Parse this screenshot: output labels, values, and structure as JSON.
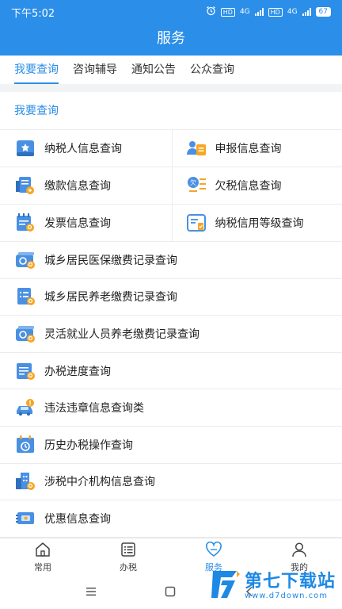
{
  "status_bar": {
    "time": "下午5:02",
    "hd1": "HD",
    "net1": "4G",
    "hd2": "HD",
    "net2": "4G",
    "battery": "67"
  },
  "header": {
    "title": "服务"
  },
  "tabs": [
    {
      "label": "我要查询",
      "active": true
    },
    {
      "label": "咨询辅导",
      "active": false
    },
    {
      "label": "通知公告",
      "active": false
    },
    {
      "label": "公众查询",
      "active": false
    }
  ],
  "section": {
    "title": "我要查询"
  },
  "grid_items": [
    {
      "label": "纳税人信息查询",
      "icon": "taxpayer-info-icon"
    },
    {
      "label": "申报信息查询",
      "icon": "declaration-info-icon"
    },
    {
      "label": "缴款信息查询",
      "icon": "payment-info-icon"
    },
    {
      "label": "欠税信息查询",
      "icon": "tax-arrears-icon"
    },
    {
      "label": "发票信息查询",
      "icon": "invoice-info-icon"
    },
    {
      "label": "纳税信用等级查询",
      "icon": "credit-rating-icon"
    }
  ],
  "list_items": [
    {
      "label": "城乡居民医保缴费记录查询",
      "icon": "medical-insurance-icon"
    },
    {
      "label": "城乡居民养老缴费记录查询",
      "icon": "pension-icon"
    },
    {
      "label": "灵活就业人员养老缴费记录查询",
      "icon": "flexible-employment-icon"
    },
    {
      "label": "办税进度查询",
      "icon": "progress-icon"
    },
    {
      "label": "违法违章信息查询类",
      "icon": "car-violation-icon"
    },
    {
      "label": "历史办税操作查询",
      "icon": "history-icon"
    },
    {
      "label": "涉税中介机构信息查询",
      "icon": "agency-building-icon"
    },
    {
      "label": "优惠信息查询",
      "icon": "discount-ticket-icon"
    }
  ],
  "bottom_nav": [
    {
      "label": "常用",
      "icon": "home-icon",
      "active": false
    },
    {
      "label": "办税",
      "icon": "list-icon",
      "active": false
    },
    {
      "label": "服务",
      "icon": "heart-icon",
      "active": true
    },
    {
      "label": "我的",
      "icon": "user-icon",
      "active": false
    }
  ],
  "watermark": {
    "name": "第七下载站",
    "url": "www.d7down.com"
  },
  "colors": {
    "primary": "#2b8ee8",
    "icon_blue": "#4a90e2",
    "icon_orange": "#f5a623"
  }
}
